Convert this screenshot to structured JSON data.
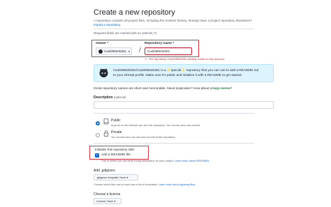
{
  "header": {
    "title": "Create a new repository",
    "subtitle": "A repository contains all project files, including the revision history. Already have a project repository elsewhere?",
    "import_link": "Import a repository."
  },
  "required_note": "Required fields are marked with an asterisk (*).",
  "owner": {
    "label": "Owner *",
    "value": "Cwd295645351"
  },
  "repo_name": {
    "label": "Repository name *",
    "value": "Cwd295645351",
    "error": "The repository Cwd295645351 already exists on this account."
  },
  "special_info": {
    "line1": "Cwd295645351/Cwd295645351 is a ✨special✨ repository that you can use to add a README.md",
    "line2": "to your GitHub profile. Make sure it's public and initialize it with a README to get started."
  },
  "great_names": {
    "prefix": "Great repository names are short and memorable. Need inspiration? How about",
    "suggestion": "crispy-meme",
    "suffix": "?"
  },
  "description": {
    "label": "Description",
    "optional": "(optional)",
    "value": ""
  },
  "visibility": {
    "public": {
      "title": "Public",
      "desc": "Anyone on the internet can see this repository. You choose who can commit."
    },
    "private": {
      "title": "Private",
      "desc": "You choose who can see and commit to this repository."
    }
  },
  "initialize": {
    "title": "Initialize this repository with:",
    "readme_label": "Add a README file",
    "readme_desc": "This is where you can write a long description for your project.",
    "readme_link": "Learn more about READMEs."
  },
  "gitignore": {
    "label": "Add .gitignore",
    "dropdown": ".gitignore template: None ▾",
    "desc": "Choose which files not to track from a list of templates.",
    "link": "Learn more about ignoring files."
  },
  "license": {
    "label": "Choose a license",
    "dropdown": "License: None ▾"
  },
  "colors": {
    "error": "#e5333d",
    "link": "#0969da",
    "info_bg": "#ddf4ff",
    "suggestion": "#1a7f37"
  }
}
